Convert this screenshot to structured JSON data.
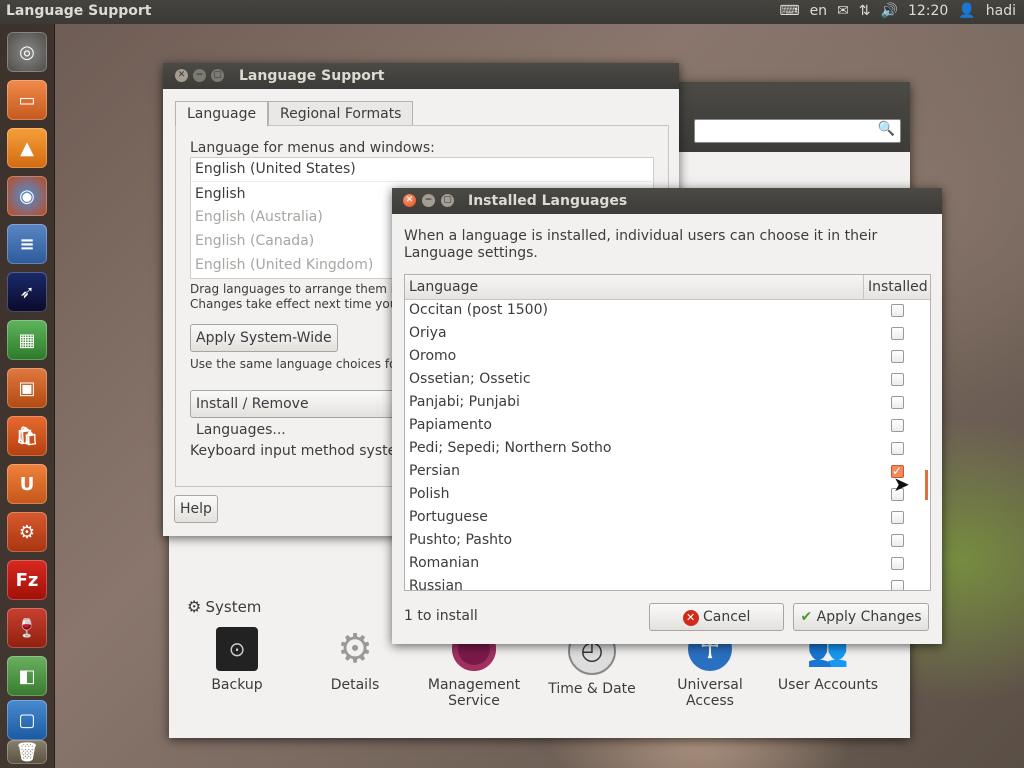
{
  "top_panel": {
    "title": "Language Support",
    "keyboard_layout": "en",
    "time": "12:20",
    "user": "hadi"
  },
  "launcher": {
    "items": [
      "dash-home",
      "files",
      "vlc",
      "firefox",
      "libreoffice-writer",
      "app-launcher",
      "libreoffice-calc",
      "libreoffice-impress",
      "software-center",
      "ubuntu-one",
      "system-settings",
      "filezilla",
      "wine",
      "diagram-app",
      "workspace-switcher",
      "trash"
    ]
  },
  "language_support_window": {
    "title": "Language Support",
    "tabs": [
      "Language",
      "Regional Formats"
    ],
    "heading": "Language for menus and windows:",
    "languages": [
      "English (United States)",
      "English",
      "English (Australia)",
      "English (Canada)",
      "English (United Kingdom)"
    ],
    "hint_line1": "Drag languages to arrange them in o",
    "hint_line2": "Changes take effect next time you lo",
    "apply_system_wide": "Apply System-Wide",
    "apply_note": "Use the same language choices for st",
    "install_remove": "Install / Remove Languages...",
    "keyboard_label": "Keyboard input method syster",
    "help": "Help"
  },
  "system_settings": {
    "section": "System",
    "items": [
      {
        "icon": "safe-icon",
        "label": "Backup"
      },
      {
        "icon": "gear-icon",
        "label": "Details"
      },
      {
        "icon": "management-icon",
        "label": "Management Service"
      },
      {
        "icon": "clock-icon",
        "label": "Time & Date"
      },
      {
        "icon": "accessibility-icon",
        "label": "Universal Access"
      },
      {
        "icon": "users-icon",
        "label": "User Accounts"
      }
    ],
    "search_placeholder": ""
  },
  "installed_languages_dialog": {
    "title": "Installed Languages",
    "description": "When a language is installed, individual users can choose it in their Language settings.",
    "col_language": "Language",
    "col_installed": "Installed",
    "rows": [
      {
        "name": "Occitan (post 1500)",
        "installed": false
      },
      {
        "name": "Oriya",
        "installed": false
      },
      {
        "name": "Oromo",
        "installed": false
      },
      {
        "name": "Ossetian; Ossetic",
        "installed": false
      },
      {
        "name": "Panjabi; Punjabi",
        "installed": false
      },
      {
        "name": "Papiamento",
        "installed": false
      },
      {
        "name": "Pedi; Sepedi; Northern Sotho",
        "installed": false
      },
      {
        "name": "Persian",
        "installed": true
      },
      {
        "name": "Polish",
        "installed": false
      },
      {
        "name": "Portuguese",
        "installed": false
      },
      {
        "name": "Pushto; Pashto",
        "installed": false
      },
      {
        "name": "Romanian",
        "installed": false
      },
      {
        "name": "Russian",
        "installed": false
      }
    ],
    "status": "1 to install",
    "cancel": "Cancel",
    "apply": "Apply Changes"
  }
}
